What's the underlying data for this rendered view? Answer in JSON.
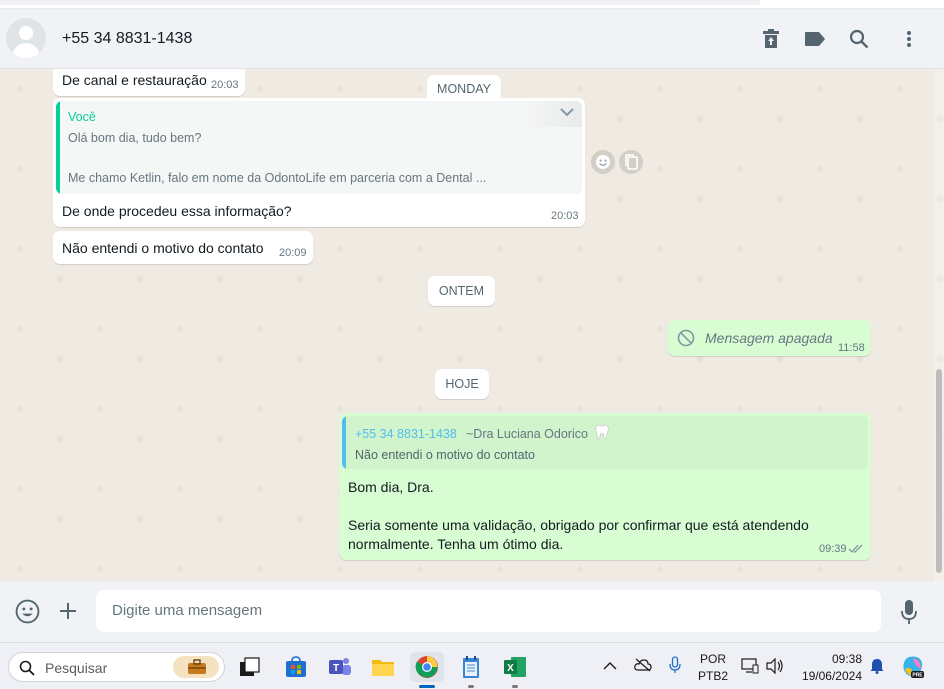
{
  "header": {
    "contact_name": "+55 34 8831-1438",
    "icons": [
      "archive-icon",
      "label-icon",
      "search-icon",
      "menu-icon"
    ]
  },
  "messages": {
    "m1": {
      "text": "De canal e restauração",
      "time": "20:03"
    },
    "day_monday": "MONDAY",
    "m2": {
      "quote_author": "Você",
      "quote_line1": "Olá bom dia, tudo bem?",
      "quote_line2": "Me chamo Ketlin, falo em nome da OdontoLife em parceria com a Dental ...",
      "text": "De onde procedeu essa informação?",
      "time": "20:03"
    },
    "m3": {
      "text": "Não entendi o motivo do contato",
      "time": "20:09"
    },
    "day_yesterday": "ONTEM",
    "m4": {
      "text": "Mensagem apagada",
      "time": "11:58"
    },
    "day_today": "HOJE",
    "m5": {
      "quote_phone": "+55 34 8831-1438",
      "quote_name": "~Dra Luciana Odorico",
      "quote_text": "Não entendi o motivo do contato",
      "line1": "Bom dia, Dra.",
      "line2": "Seria somente uma validação, obrigado por confirmar que está atendendo",
      "line3": "normalmente. Tenha um ótimo dia.",
      "time": "09:39"
    }
  },
  "composer": {
    "placeholder": "Digite uma mensagem"
  },
  "taskbar": {
    "search_label": "Pesquisar",
    "lang_top": "POR",
    "lang_bottom": "PTB2",
    "time": "09:38",
    "date": "19/06/2024"
  },
  "colors": {
    "chat_bg": "#efeae2",
    "outgoing_bubble": "#d9fdd3",
    "quote_green": "#06cf9c",
    "quote_blue": "#53bdeb"
  }
}
